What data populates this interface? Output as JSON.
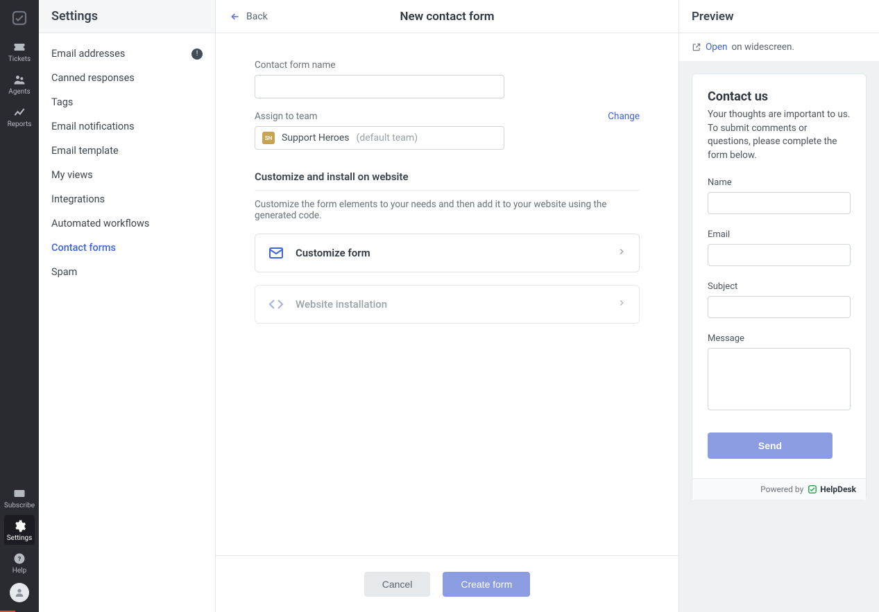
{
  "rail": {
    "items": [
      {
        "label": "Tickets"
      },
      {
        "label": "Agents"
      },
      {
        "label": "Reports"
      }
    ],
    "bottom": [
      {
        "label": "Subscribe"
      },
      {
        "label": "Settings"
      },
      {
        "label": "Help"
      }
    ]
  },
  "sidebar": {
    "title": "Settings",
    "items": [
      {
        "label": "Email addresses",
        "badge": "!"
      },
      {
        "label": "Canned responses"
      },
      {
        "label": "Tags"
      },
      {
        "label": "Email notifications"
      },
      {
        "label": "Email template"
      },
      {
        "label": "My views"
      },
      {
        "label": "Integrations"
      },
      {
        "label": "Automated workflows"
      },
      {
        "label": "Contact forms",
        "active": true
      },
      {
        "label": "Spam"
      }
    ]
  },
  "main": {
    "back_label": "Back",
    "title": "New contact form",
    "form_name_label": "Contact form name",
    "form_name_value": "",
    "assign_label": "Assign to team",
    "change_link": "Change",
    "team": {
      "chip": "SH",
      "name": "Support Heroes",
      "suffix": "(default team)"
    },
    "section_title": "Customize and install on website",
    "section_desc": "Customize the form elements to your needs and then add it to your website using the generated code.",
    "cards": [
      {
        "label": "Customize form"
      },
      {
        "label": "Website installation"
      }
    ],
    "footer": {
      "cancel": "Cancel",
      "create": "Create form"
    }
  },
  "preview": {
    "title": "Preview",
    "open_link": "Open",
    "open_suffix": "on widescreen.",
    "card": {
      "title": "Contact us",
      "subtitle": "Your thoughts are important to us. To submit comments or questions, please complete the form below.",
      "fields": [
        {
          "label": "Name"
        },
        {
          "label": "Email"
        },
        {
          "label": "Subject"
        },
        {
          "label": "Message",
          "multiline": true
        }
      ],
      "send": "Send",
      "powered_by": "Powered by",
      "brand": "HelpDesk"
    }
  }
}
